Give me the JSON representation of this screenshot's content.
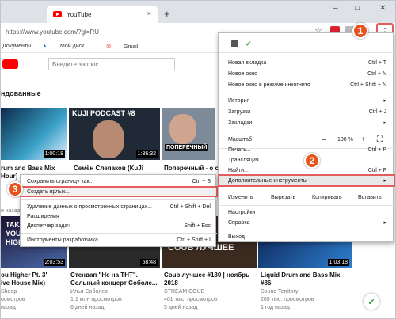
{
  "browser": {
    "tab_title": "YouTube",
    "tab_close": "×",
    "new_tab": "+",
    "url": "https://www.youtube.com/?gl=RU",
    "window_min": "–",
    "window_max": "□",
    "window_close": "✕",
    "menu_dots": "⋮"
  },
  "bookmarks": [
    "Документы",
    "Мой диск",
    "Gmail"
  ],
  "youtube": {
    "search_placeholder": "Введите запрос",
    "section_title": "ндованные",
    "row1": [
      {
        "title": "rum and Bass Mix",
        "sub": "Hour]",
        "duration": "1:00:18"
      },
      {
        "title": "Семён Слепаков (KuJi",
        "thumb_text": "KUJI PODCAST #8",
        "duration": "1:36:32"
      },
      {
        "title": "Поперечный - о с",
        "thumb_text": "ПОПЕРЕЧНЫЙ",
        "duration": ""
      }
    ],
    "row2": [
      {
        "title": "ou Higher Pt. 3'",
        "title2": "ive House Mix)",
        "ch": "Sheep",
        "views": "осмотров",
        "age": "назад",
        "duration": "2:03:53",
        "thumb_text": "TAKE YOU HIGHER"
      },
      {
        "title": "Стендап \"Не на ТНТ\".",
        "title2": "Сольный концерт Соболе...",
        "ch": "Илья Соболев",
        "views": "1,1 млн просмотров",
        "age": "6 дней назад",
        "duration": "58:48"
      },
      {
        "title": "Coub лучшее #180 | ноябрь",
        "title2": "2018",
        "ch": "STREAM COUB",
        "views": "401 тыс. просмотров",
        "age": "5 дней назад",
        "duration": "",
        "thumb_text": "COUB ЛУЧШЕЕ"
      },
      {
        "title": "Liquid Drum and Bass Mix",
        "title2": "#86",
        "ch": "Sound Territory",
        "views": "205 тыс. просмотров",
        "age": "1 год назад",
        "duration": "1:03:18"
      }
    ],
    "left_cut": "н назад"
  },
  "context_menu": {
    "items": [
      {
        "label": "Сохранить страницу как...",
        "shortcut": "Ctrl + S"
      },
      {
        "label": "Создать ярлык...",
        "shortcut": ""
      },
      {
        "label": "Удаление данных о просмотренных страницах...",
        "shortcut": "Ctrl + Shift + Del"
      },
      {
        "label": "Расширения",
        "shortcut": ""
      },
      {
        "label": "Диспетчер задач",
        "shortcut": "Shift + Esc"
      },
      {
        "label": "Инструменты разработчика",
        "shortcut": "Ctrl + Shift + I"
      }
    ]
  },
  "main_menu": {
    "items": [
      {
        "label": "Новая вкладка",
        "shortcut": "Ctrl + T"
      },
      {
        "label": "Новое окно",
        "shortcut": "Ctrl + N"
      },
      {
        "label": "Новое окно в режиме инкогнито",
        "shortcut": "Ctrl + Shift + N"
      },
      {
        "label": "История",
        "shortcut": "▸"
      },
      {
        "label": "Загрузки",
        "shortcut": "Ctrl + J"
      },
      {
        "label": "Закладки",
        "shortcut": "▸"
      },
      {
        "label": "Масштаб",
        "shortcut": ""
      },
      {
        "label": "Печать...",
        "shortcut": "Ctrl + P"
      },
      {
        "label": "Трансляция...",
        "shortcut": ""
      },
      {
        "label": "Найти...",
        "shortcut": "Ctrl + F"
      },
      {
        "label": "Дополнительные инструменты",
        "shortcut": "▸"
      },
      {
        "label": "Настройки",
        "shortcut": ""
      },
      {
        "label": "Справка",
        "shortcut": "▸"
      },
      {
        "label": "Выход",
        "shortcut": ""
      }
    ],
    "zoom": {
      "minus": "–",
      "value": "100 %",
      "plus": "+",
      "fullscreen": "⛶"
    },
    "edit": {
      "label": "Изменить",
      "cut": "Вырезать",
      "copy": "Копировать",
      "paste": "Вставить"
    }
  },
  "badges": {
    "one": "1",
    "two": "2",
    "three": "3"
  },
  "colors": {
    "badge": "#e8541e",
    "highlight": "#e45d5d",
    "youtube_red": "#ff0000"
  }
}
